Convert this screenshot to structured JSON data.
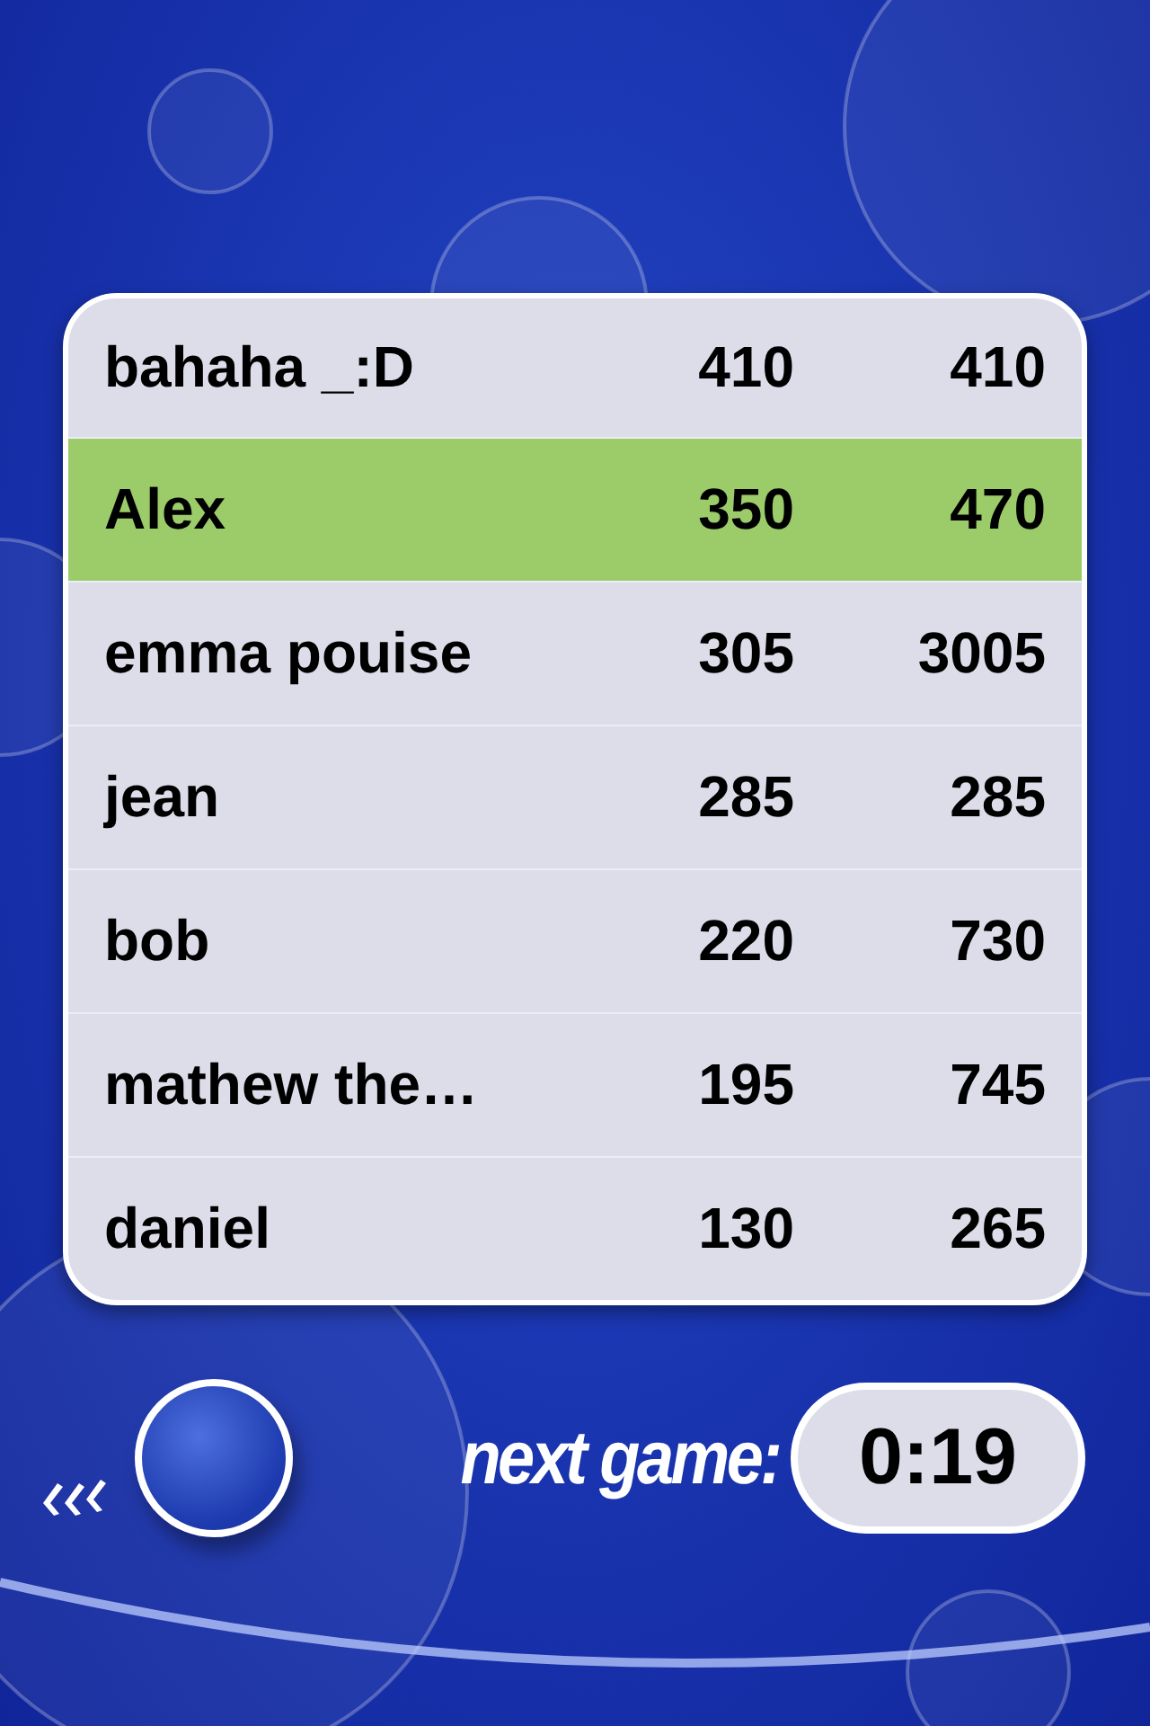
{
  "scores": [
    {
      "name": "bahaha _:D",
      "score": "410",
      "total": "410",
      "selected": false
    },
    {
      "name": "Alex",
      "score": "350",
      "total": "470",
      "selected": true
    },
    {
      "name": "emma pouise",
      "score": "305",
      "total": "3005",
      "selected": false
    },
    {
      "name": "jean",
      "score": "285",
      "total": "285",
      "selected": false
    },
    {
      "name": "bob",
      "score": "220",
      "total": "730",
      "selected": false
    },
    {
      "name": "mathew the…",
      "score": "195",
      "total": "745",
      "selected": false
    },
    {
      "name": "daniel",
      "score": "130",
      "total": "265",
      "selected": false
    }
  ],
  "footer": {
    "label": "next game:",
    "timer": "0:19"
  }
}
